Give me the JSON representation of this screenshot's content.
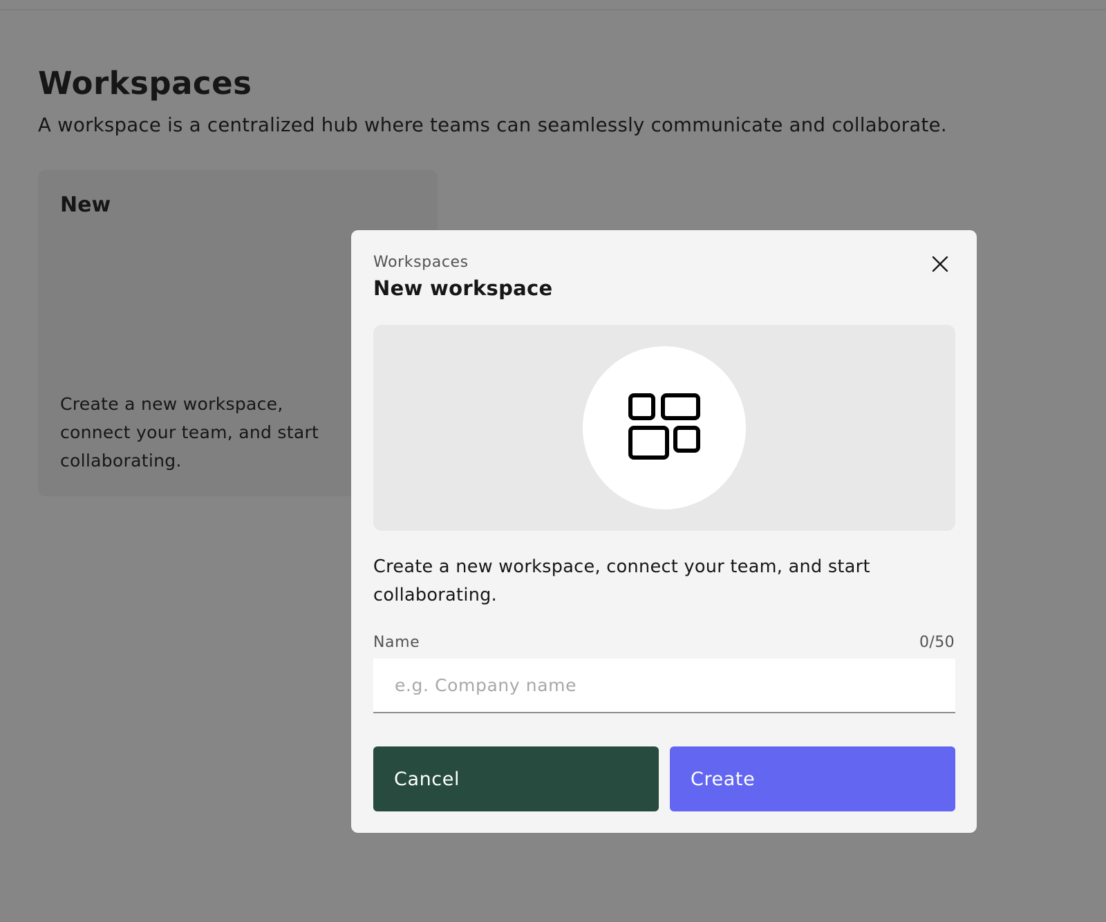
{
  "page": {
    "title": "Workspaces",
    "description": "A workspace is a centralized hub where teams can seamlessly communicate and collaborate.",
    "new_card": {
      "title": "New",
      "description": "Create a new workspace, connect your team, and start collaborating."
    }
  },
  "modal": {
    "eyebrow": "Workspaces",
    "title": "New workspace",
    "close_icon": "close-icon",
    "hero_icon": "grid-icon",
    "description": "Create a new workspace, connect your team, and start collaborating.",
    "name_field": {
      "label": "Name",
      "counter": "0/50",
      "value": "",
      "placeholder": "e.g. Company name"
    },
    "cancel_label": "Cancel",
    "create_label": "Create"
  },
  "colors": {
    "cancel_button": "#274b3e",
    "create_button": "#6366f1",
    "overlay": "rgba(22,22,22,0.5)"
  }
}
